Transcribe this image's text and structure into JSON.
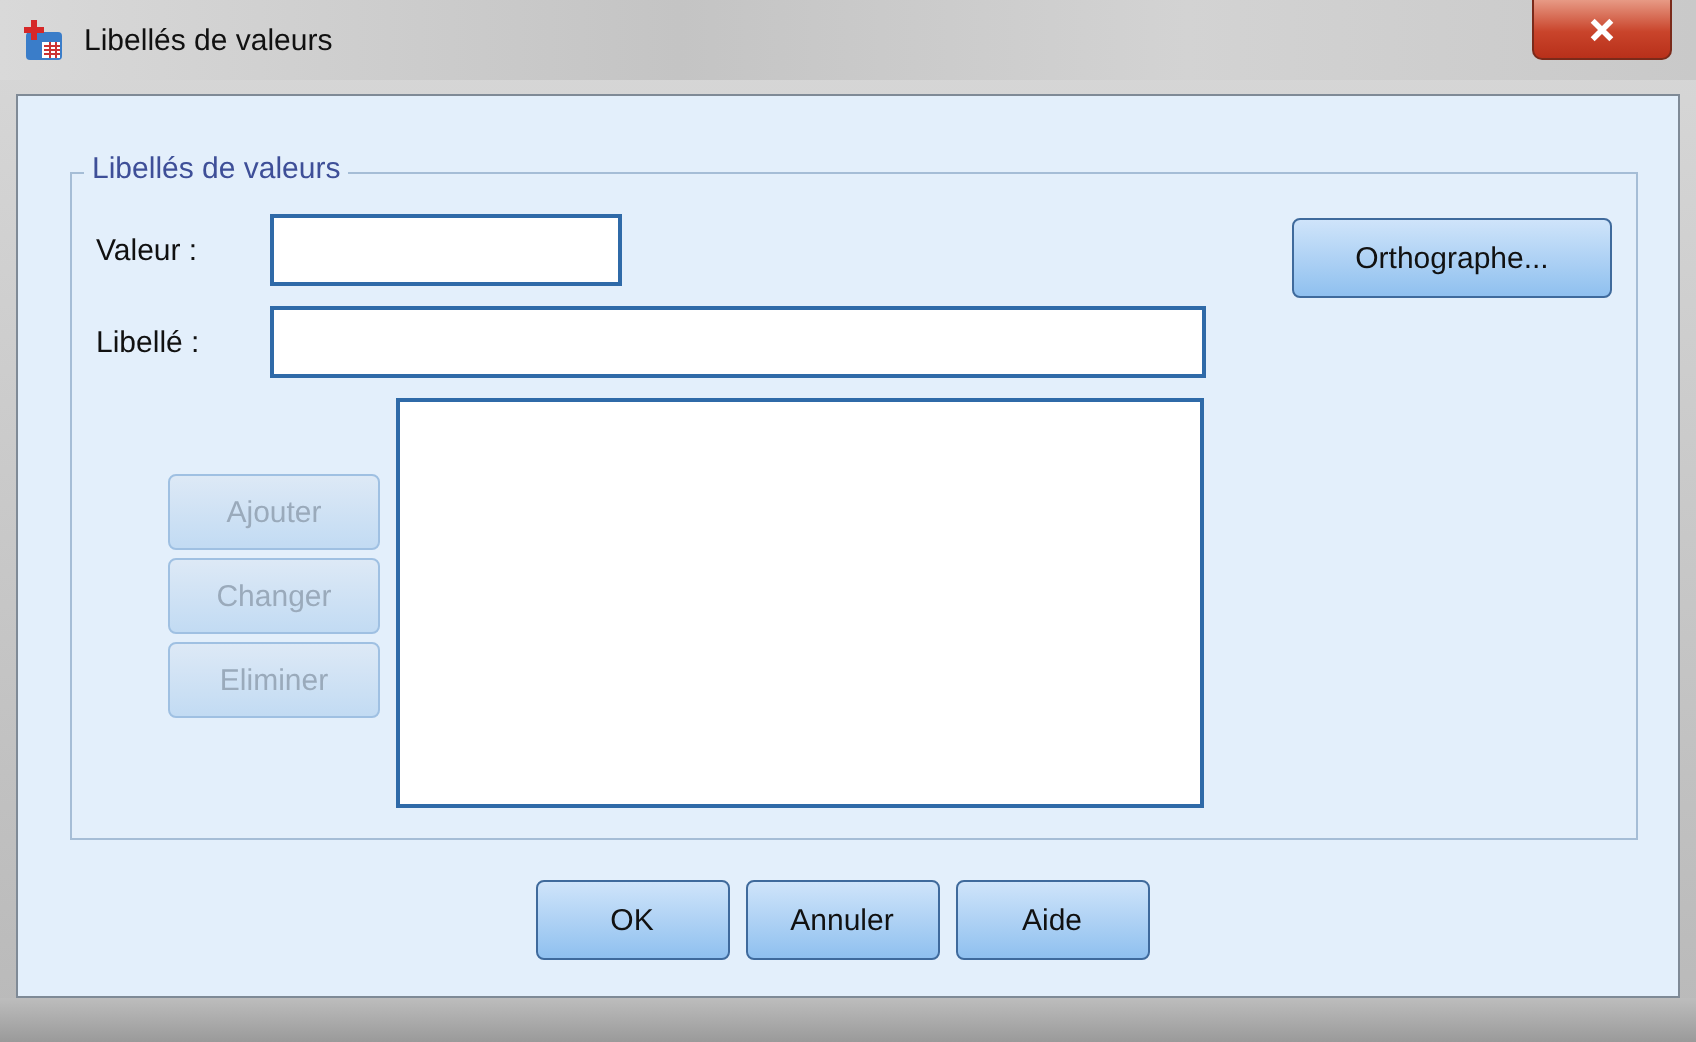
{
  "window": {
    "title": "Libellés de valeurs"
  },
  "group": {
    "title": "Libellés de valeurs"
  },
  "fields": [
    {
      "label": "Valeur :"
    },
    {
      "label": "Libellé :"
    }
  ],
  "side_buttons": [
    {
      "label": "Ajouter",
      "disabled": true
    },
    {
      "label": "Changer",
      "disabled": true
    },
    {
      "label": "Eliminer",
      "disabled": true
    }
  ],
  "spelling_button": {
    "label": "Orthographe..."
  },
  "buttons": [
    {
      "label": "OK"
    },
    {
      "label": "Annuler"
    },
    {
      "label": "Aide"
    }
  ]
}
